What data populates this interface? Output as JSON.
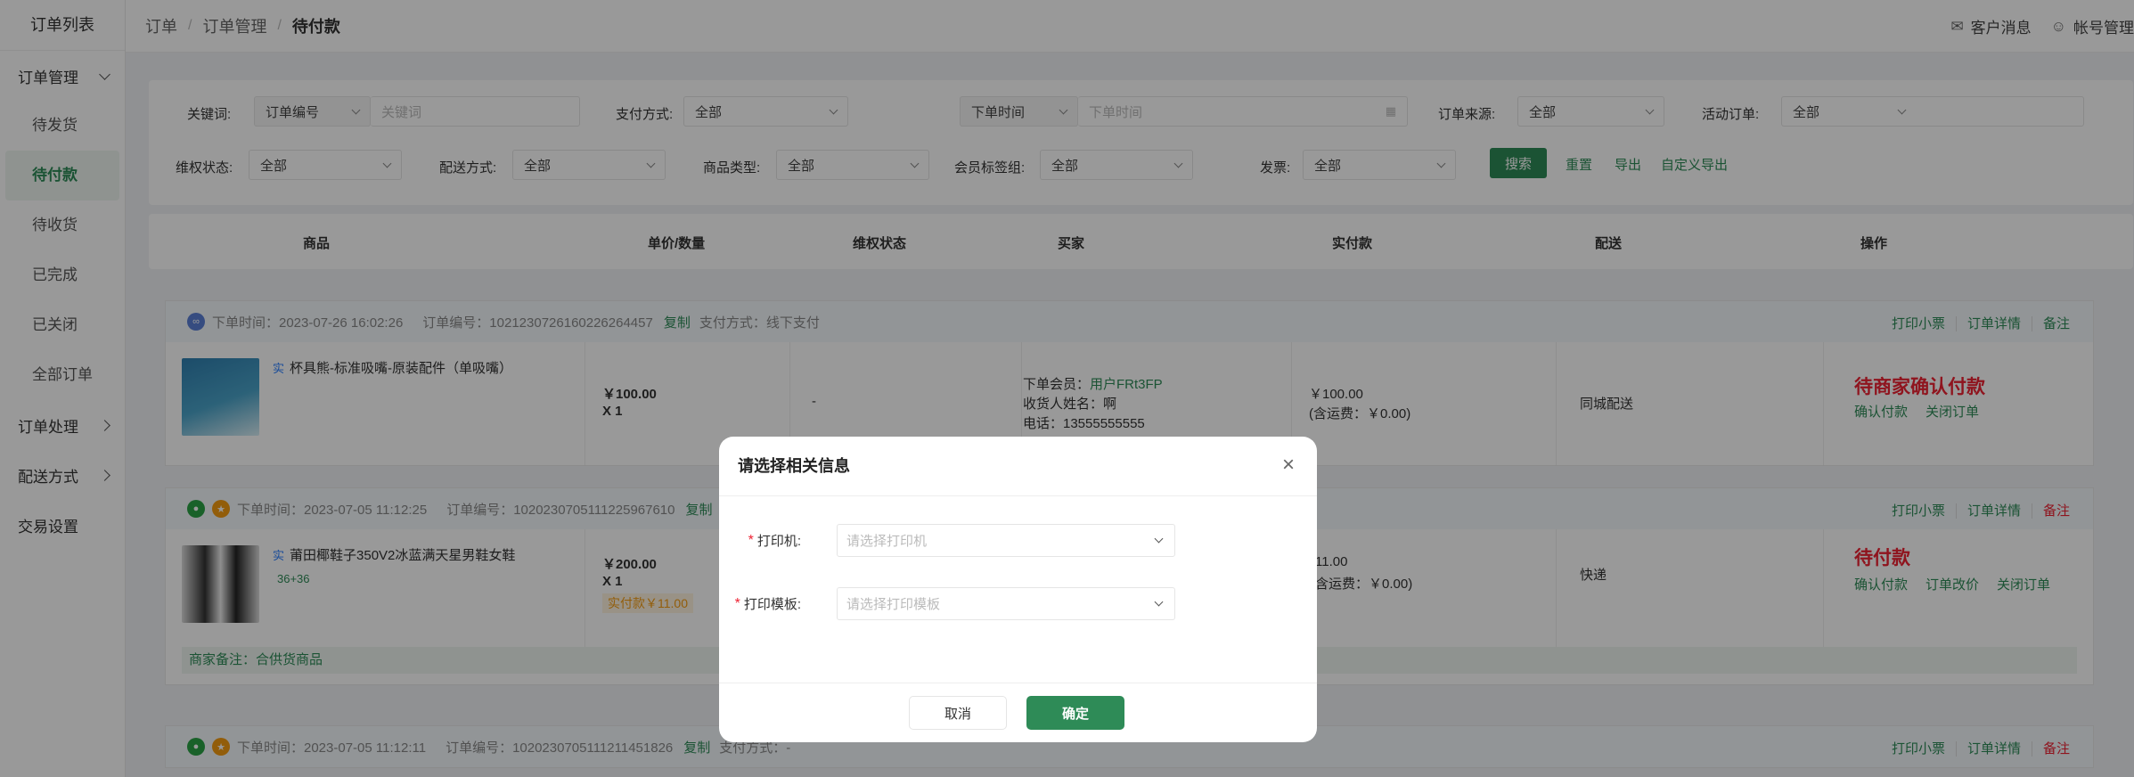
{
  "sidebar": {
    "title": "订单列表",
    "groups": [
      {
        "label": "订单管理",
        "items": [
          "待发货",
          "待付款",
          "待收货",
          "已完成",
          "已关闭",
          "全部订单"
        ]
      },
      {
        "label": "订单处理"
      },
      {
        "label": "配送方式"
      },
      {
        "label": "交易设置"
      }
    ]
  },
  "breadcrumb": [
    "订单",
    "订单管理",
    "待付款"
  ],
  "topbar": {
    "messages": "客户消息",
    "account": "帐号管理"
  },
  "filters": {
    "keyword_label": "关键词:",
    "keyword_type": "订单编号",
    "keyword_placeholder": "关键词",
    "pay_label": "支付方式:",
    "pay_value": "全部",
    "time_type": "下单时间",
    "time_placeholder": "下单时间",
    "source_label": "订单来源:",
    "source_value": "全部",
    "activity_label": "活动订单:",
    "activity_value": "全部",
    "rights_label": "维权状态:",
    "rights_value": "全部",
    "delivery_label": "配送方式:",
    "delivery_value": "全部",
    "goods_label": "商品类型:",
    "goods_value": "全部",
    "member_label": "会员标签组:",
    "member_value": "全部",
    "invoice_label": "发票:",
    "invoice_value": "全部",
    "search": "搜索",
    "reset": "重置",
    "export": "导出",
    "custom_export": "自定义导出"
  },
  "table_headers": [
    "商品",
    "单价/数量",
    "维权状态",
    "买家",
    "实付款",
    "配送",
    "操作"
  ],
  "orders": [
    {
      "time": "下单时间：2023-07-26 16:02:26",
      "no": "订单编号：1021230726160226264457",
      "copy": "复制",
      "pay": "支付方式：线下支付",
      "actions": [
        "打印小票",
        "订单详情",
        "备注"
      ],
      "tag": "实",
      "product": "杯具熊-标准吸嘴-原装配件（单吸嘴）",
      "price": "￥100.00",
      "qty": "X 1",
      "rights": "-",
      "buyer_member_label": "下单会员：",
      "buyer_member": "用户FRt3FP",
      "buyer_name": "收货人姓名：啊",
      "buyer_phone": "电话：13555555555",
      "paid": "￥100.00",
      "paid_note": "(含运费：￥0.00)",
      "delivery": "同城配送",
      "status": "待商家确认付款",
      "ops": [
        "确认付款",
        "关闭订单"
      ]
    },
    {
      "time": "下单时间：2023-07-05 11:12:25",
      "no": "订单编号：1020230705111225967610",
      "copy": "复制",
      "actions": [
        "打印小票",
        "订单详情",
        "备注"
      ],
      "tag": "实",
      "product": "莆田椰鞋子350V2冰蓝满天星男鞋女鞋",
      "spec": "36+36",
      "price": "￥200.00",
      "qty": "X 1",
      "real_pay": "实付款￥11.00",
      "paid": "11.00",
      "paid_note": "含运费：￥0.00)",
      "delivery": "快递",
      "status": "待付款",
      "ops": [
        "确认付款",
        "订单改价",
        "关闭订单"
      ],
      "merchant_note": "商家备注：合供货商品"
    },
    {
      "time": "下单时间：2023-07-05 11:12:11",
      "no": "订单编号：1020230705111211451826",
      "copy": "复制",
      "pay": "支付方式：-",
      "actions": [
        "打印小票",
        "订单详情",
        "备注"
      ]
    }
  ],
  "dialog": {
    "title": "请选择相关信息",
    "printer_label": "打印机:",
    "printer_placeholder": "请选择打印机",
    "template_label": "打印模板:",
    "template_placeholder": "请选择打印模板",
    "cancel": "取消",
    "confirm": "确定"
  },
  "colors": {
    "primary": "#2e8b57",
    "danger": "#e22233",
    "mask": "rgba(0,0,0,0.4)"
  }
}
